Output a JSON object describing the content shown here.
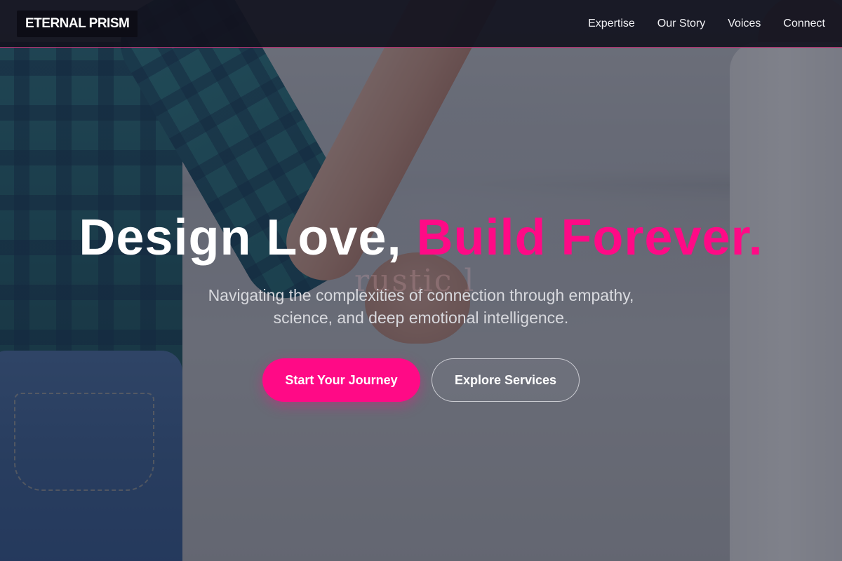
{
  "brand": {
    "logo_text": "ETERNAL PRISM"
  },
  "nav": {
    "items": [
      {
        "label": "Expertise"
      },
      {
        "label": "Our Story"
      },
      {
        "label": "Voices"
      },
      {
        "label": "Connect"
      }
    ]
  },
  "hero": {
    "headline_main": "Design Love, ",
    "headline_accent": "Build Forever.",
    "subtitle": "Navigating the complexities of connection through empathy, science, and deep emotional intelligence.",
    "primary_cta": "Start Your Journey",
    "secondary_cta": "Explore Services",
    "background_description": "couple holding hands on a beach",
    "watermark_text": "rustic l"
  },
  "colors": {
    "accent": "#ff0a86",
    "nav_background": "#12121e",
    "text_light": "#ffffff"
  }
}
